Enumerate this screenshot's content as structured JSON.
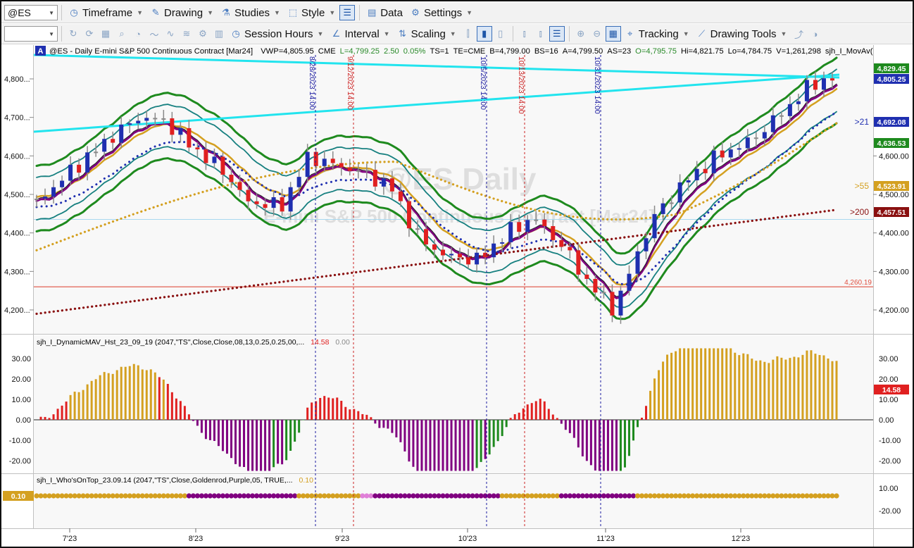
{
  "toolbar1": {
    "symbol": "@ES",
    "timeframe": "Timeframe",
    "drawing": "Drawing",
    "studies": "Studies",
    "style": "Style",
    "data": "Data",
    "settings": "Settings"
  },
  "toolbar2": {
    "session_hours": "Session Hours",
    "interval": "Interval",
    "scaling": "Scaling",
    "tracking": "Tracking",
    "drawing_tools": "Drawing Tools"
  },
  "chart": {
    "badge": "A",
    "header": "@ES - Daily  E-mini S&P 500 Continuous Contract [Mar24]",
    "stats": [
      {
        "text": "VWP=4,805.95",
        "color": "#000000"
      },
      {
        "text": "CME",
        "color": "#000000"
      },
      {
        "text": "L=4,799.25",
        "color": "#2a8a2a"
      },
      {
        "text": "2.50",
        "color": "#2a8a2a"
      },
      {
        "text": "0.05%",
        "color": "#2a8a2a"
      },
      {
        "text": "TS=1",
        "color": "#000000"
      },
      {
        "text": "TE=CME",
        "color": "#000000"
      },
      {
        "text": "B=4,799.00",
        "color": "#000000"
      },
      {
        "text": "BS=16",
        "color": "#000000"
      },
      {
        "text": "A=4,799.50",
        "color": "#000000"
      },
      {
        "text": "AS=23",
        "color": "#000000"
      },
      {
        "text": "O=4,795.75",
        "color": "#2a8a2a"
      },
      {
        "text": "Hi=4,821.75",
        "color": "#000000"
      },
      {
        "text": "Lo=4,784.75",
        "color": "#000000"
      },
      {
        "text": "V=1,261,298",
        "color": "#000000"
      },
      {
        "text": "sjh_I_MovAv(",
        "color": "#000000"
      }
    ],
    "watermark_line1": "@ES Daily",
    "watermark_line2": "E-mini S&P 500 Continuous Contract [Mar24]",
    "price_ticks": [
      "4,800...",
      "4,700...",
      "4,600...",
      "4,500...",
      "4,400...",
      "4,300...",
      "4,200..."
    ],
    "right_ticks": [
      "4,600.00",
      "4,500.00",
      "4,400.00",
      "4,300.00",
      "4,200.00"
    ],
    "price_labels": [
      {
        "text": "4,829.45",
        "bg": "#1e8a1e"
      },
      {
        "text": "4,805.25",
        "bg": "#1f2fb0"
      },
      {
        "text": "4,692.08",
        "bg": "#1f2fb0"
      },
      {
        "text": "4,636.53",
        "bg": "#1e8a1e"
      },
      {
        "text": "4,523.91",
        "bg": "#d4a020"
      },
      {
        "text": "4,457.51",
        "bg": "#8a1010"
      }
    ],
    "ma_labels": [
      {
        "text": ">21",
        "color": "#1f2fb0"
      },
      {
        "text": ">55",
        "color": "#d4a020"
      },
      {
        "text": ">200",
        "color": "#8a1010"
      }
    ],
    "support_label": "4,260.19",
    "date_markers": [
      {
        "text": "8/28/2023 14:00",
        "color": "#1a1aa0"
      },
      {
        "text": "9/12/2023 14:00",
        "color": "#cc2222"
      },
      {
        "text": "10/5/2023 14:00",
        "color": "#1a1aa0"
      },
      {
        "text": "10/13/2023 14:00",
        "color": "#cc2222"
      },
      {
        "text": "10/31/2023 14:00",
        "color": "#1a1aa0"
      }
    ],
    "x_ticks": [
      "7'23",
      "8'23",
      "9'23",
      "10'23",
      "11'23",
      "12'23"
    ]
  },
  "indicator1": {
    "title": "sjh_I_DynamicMAV_Hst_23_09_19 (2047,\"TS\",Close,Close,08,13,0.25,0.25,00,...",
    "value1": "14.58",
    "value2": "0.00",
    "ticks": [
      "30.00",
      "20.00",
      "10.00",
      "0.00",
      "-10.00",
      "-20.00"
    ],
    "right_ticks": [
      "30.00",
      "20.00",
      "10.00",
      "0.00",
      "-10.00",
      "-20.00"
    ],
    "current_label": "14.58"
  },
  "indicator2": {
    "title": "sjh_I_Who'sOnTop_23.09.14 (2047,\"TS\",Close,Goldenrod,Purple,05,  TRUE,...",
    "value": "0.10",
    "left_label": "0.10",
    "right_ticks": [
      "10.00",
      "-20.00"
    ]
  },
  "colors": {
    "up_candle": "#1f2fb0",
    "down_candle": "#e02020",
    "neutral_candle": "#8a8a8a",
    "trendline": "#22e4ee",
    "band_outer": "#1e8a1e",
    "band_inner": "#178080",
    "goldenrod": "#d4a020",
    "purple": "#800080",
    "ma21": "#1f2fb0",
    "ma200": "#8a1010",
    "support": "#e05040"
  },
  "icons": {
    "timeframe": "clock-icon",
    "drawing": "pen-icon",
    "studies": "studies-icon",
    "style": "style-icon",
    "data": "data-icon",
    "settings": "gear-icon"
  }
}
